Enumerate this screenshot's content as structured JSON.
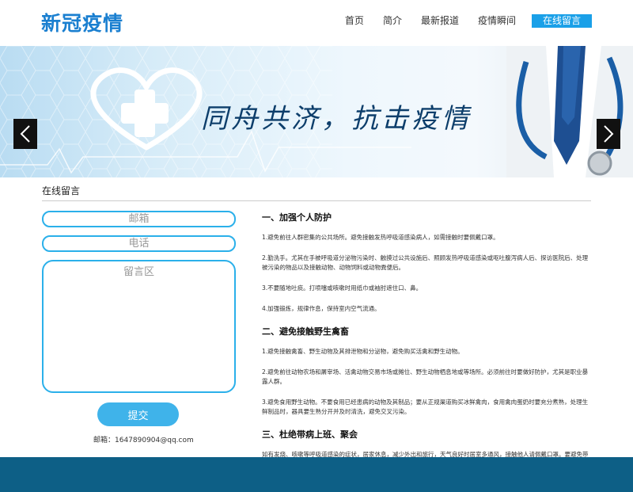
{
  "header": {
    "logo": "新冠疫情",
    "nav": [
      "首页",
      "简介",
      "最新报道",
      "疫情瞬间"
    ],
    "nav_active": "在线留言"
  },
  "banner": {
    "slogan": "同舟共济，抗击疫情",
    "prev_icon": "chevron-left-icon",
    "next_icon": "chevron-right-icon"
  },
  "section": {
    "title": "在线留言"
  },
  "form": {
    "email_placeholder": "邮箱",
    "phone_placeholder": "电话",
    "message_placeholder": "留言区",
    "submit_label": "提交",
    "contact": "邮箱：1647890904@qq.com"
  },
  "article": {
    "h1": "一、加强个人防护",
    "s1": [
      "1.避免前往人群密集的公共场所。避免接触发热呼吸道感染病人，如需接触时要佩戴口罩。",
      "2.勤洗手。尤其在手被呼吸道分泌物污染时、触摸过公共设施后、照顾发热呼吸道感染或呕吐腹泻病人后、探访医院后、处理被污染的物品以及接触动物、动物饲料或动物粪便后。",
      "3.不要随地吐痰。打喷嚏或咳嗽时用纸巾或袖肘遮住口、鼻。",
      "4.加强锻炼，规律作息，保持室内空气流通。"
    ],
    "h2": "二、避免接触野生禽畜",
    "s2": [
      "1.避免接触禽畜、野生动物及其排泄物和分泌物，避免购买活禽和野生动物。",
      "2.避免前往动物农场和屠宰场、活禽动物交易市场或摊位、野生动物栖息地或等场所。必须前往时要做好防护，尤其是职业暴露人群。",
      "3.避免食用野生动物。不要食用已经患病的动物及其制品；要从正规渠道购买冰鲜禽肉，食用禽肉蛋奶时要充分煮熟，处理生鲜制品时，器具要生熟分开并及时清洗，避免交叉污染。"
    ],
    "h3": "三、杜绝带病上班、聚会",
    "s3": [
      "如有发烧、咳嗽等呼吸道感染的症状，居家休息，减少外出和旅行，天气良好时居室多通风，接触他人请佩戴口罩。要避免带病上班、上课及聚会。"
    ]
  },
  "colors": {
    "accent": "#1aa0e8",
    "footer": "#0d5f86",
    "logo": "#1a7fd0"
  }
}
